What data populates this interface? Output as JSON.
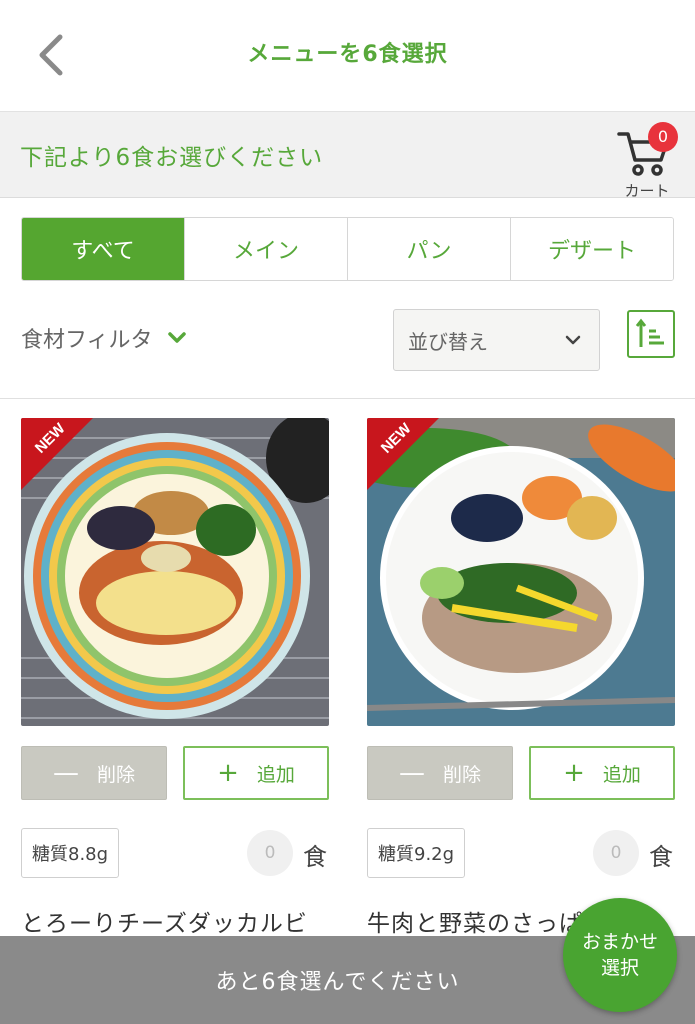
{
  "header": {
    "title": "メニューを6食選択"
  },
  "instruction": {
    "text": "下記より6食お選びください",
    "cart_label": "カート",
    "cart_count": "0"
  },
  "tabs": [
    {
      "label": "すべて",
      "active": true
    },
    {
      "label": "メイン",
      "active": false
    },
    {
      "label": "パン",
      "active": false
    },
    {
      "label": "デザート",
      "active": false
    }
  ],
  "filter": {
    "ingredient_label": "食材フィルタ",
    "sort_label": "並び替え"
  },
  "cards": [
    {
      "badge": "NEW",
      "remove_label": "削除",
      "add_label": "追加",
      "sugar": "糖質8.8g",
      "quantity": "0",
      "unit": "食",
      "name": "とろーりチーズダッカルビ"
    },
    {
      "badge": "NEW",
      "remove_label": "削除",
      "add_label": "追加",
      "sugar": "糖質9.2g",
      "quantity": "0",
      "unit": "食",
      "name": "牛肉と野菜のさっぱり"
    }
  ],
  "bottom_bar": {
    "text": "あと6食選んでください"
  },
  "omakase": {
    "line1": "おまかせ",
    "line2": "選択"
  },
  "colors": {
    "accent_green": "#57a83a",
    "badge_red": "#e8333c",
    "bottom_gray": "#8a8a8a"
  }
}
